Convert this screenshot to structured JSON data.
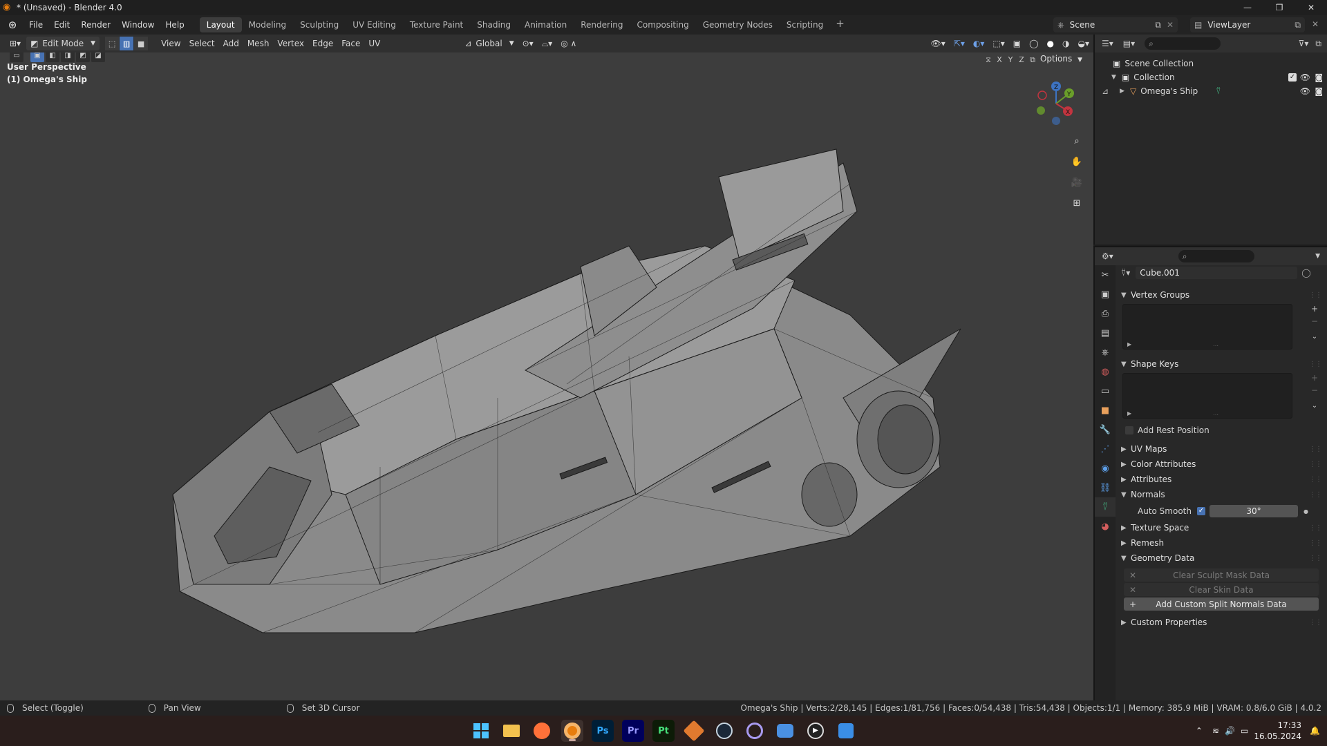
{
  "window": {
    "title": "* (Unsaved) - Blender 4.0",
    "controls": {
      "minimize": "—",
      "restore": "❐",
      "close": "✕"
    }
  },
  "menu": [
    "File",
    "Edit",
    "Render",
    "Window",
    "Help"
  ],
  "workspaces": [
    "Layout",
    "Modeling",
    "Sculpting",
    "UV Editing",
    "Texture Paint",
    "Shading",
    "Animation",
    "Rendering",
    "Compositing",
    "Geometry Nodes",
    "Scripting"
  ],
  "active_workspace": "Layout",
  "scene": {
    "name": "Scene",
    "view_layer": "ViewLayer"
  },
  "viewport_header": {
    "mode": "Edit Mode",
    "menus": [
      "View",
      "Select",
      "Add",
      "Mesh",
      "Vertex",
      "Edge",
      "Face",
      "UV"
    ],
    "transform_orientation": "Global",
    "options_label": "Options",
    "axis_labels": [
      "X",
      "Y",
      "Z"
    ]
  },
  "viewport": {
    "view_name": "User Perspective",
    "object_label": "(1) Omega's Ship",
    "gizmo": {
      "x": "X",
      "y": "Y",
      "z": "Z"
    }
  },
  "outliner": {
    "root": "Scene Collection",
    "collection": "Collection",
    "object": "Omega's Ship"
  },
  "properties": {
    "data_name": "Cube.001",
    "panels": {
      "vertex_groups": "Vertex Groups",
      "shape_keys": "Shape Keys",
      "add_rest_position": "Add Rest Position",
      "uv_maps": "UV Maps",
      "color_attributes": "Color Attributes",
      "attributes": "Attributes",
      "normals": "Normals",
      "auto_smooth_label": "Auto Smooth",
      "auto_smooth_angle": "30°",
      "texture_space": "Texture Space",
      "remesh": "Remesh",
      "geometry_data": "Geometry Data",
      "clear_sculpt_mask": "Clear Sculpt Mask Data",
      "clear_skin": "Clear Skin Data",
      "add_custom_split_normals": "Add Custom Split Normals Data",
      "custom_properties": "Custom Properties"
    }
  },
  "statusbar": {
    "hints": [
      "Select (Toggle)",
      "Pan View",
      "Set 3D Cursor"
    ],
    "stats": "Omega's Ship | Verts:2/28,145 | Edges:1/81,756 | Faces:0/54,438 | Tris:54,438 | Objects:1/1 | Memory: 385.9 MiB | VRAM: 0.8/6.0 GiB | 4.0.2"
  },
  "taskbar": {
    "apps": [
      {
        "name": "start-icon",
        "label": "",
        "color": "#4cc2ff"
      },
      {
        "name": "file-explorer-icon",
        "label": "",
        "color": "#f2c14e"
      },
      {
        "name": "firefox-icon",
        "label": "",
        "color": "#ff7139"
      },
      {
        "name": "blender-icon",
        "label": "",
        "color": "#e87d0d"
      },
      {
        "name": "photoshop-icon",
        "label": "Ps",
        "color": "#001e36"
      },
      {
        "name": "premiere-icon",
        "label": "Pr",
        "color": "#00005b"
      },
      {
        "name": "substance-painter-icon",
        "label": "Pt",
        "color": "#0d1b07"
      },
      {
        "name": "box-app-icon",
        "label": "",
        "color": "#e07a2f"
      },
      {
        "name": "steam-icon",
        "label": "",
        "color": "#1b2838"
      },
      {
        "name": "swirl-app-icon",
        "label": "",
        "color": "#6b5bd6"
      },
      {
        "name": "chat-app-icon",
        "label": "",
        "color": "#4a90e2"
      },
      {
        "name": "media-player-icon",
        "label": "",
        "color": "#444444"
      },
      {
        "name": "paint-app-icon",
        "label": "",
        "color": "#3a8ee6"
      }
    ],
    "time": "17:33",
    "date": "16.05.2024"
  }
}
